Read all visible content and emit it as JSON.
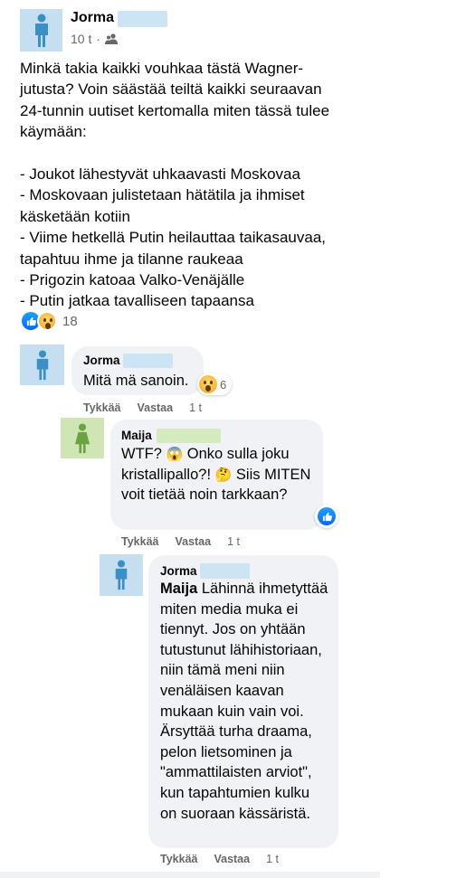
{
  "post": {
    "author": "Jorma",
    "time": "10 t",
    "separator": "·",
    "audience_icon": "friends-icon",
    "text": "Minkä takia kaikki vouhkaa tästä Wagner-\njutusta? Voin säästää teiltä kaikki seuraavan\n24-tunnin uutiset kertomalla miten tässä tulee\nkäymään:\n\n- Joukot lähestyvät uhkaavasti Moskovaa\n- Moskovaan julistetaan hätätila ja ihmiset\nkäsketään kotiin\n- Viime hetkellä Putin heilauttaa taikasauvaa,\ntapahtuu ihme ja tilanne raukeaa\n- Prigozin katoaa Valko-Venäjälle\n- Putin jatkaa tavalliseen tapaansa",
    "reactions": {
      "icons": [
        "like-icon",
        "wow-icon"
      ],
      "count": "18"
    }
  },
  "comments": [
    {
      "author": "Jorma",
      "text": "Mitä mä sanoin.",
      "reaction": {
        "icon": "wow-icon",
        "count": "6"
      },
      "like_label": "Tykkää",
      "reply_label": "Vastaa",
      "time": "1 t"
    },
    {
      "author": "Maija",
      "text_parts": [
        "WTF? ",
        " Onko sulla joku kristallipallo?! ",
        " Siis MITEN voit tietää noin tarkkaan?"
      ],
      "emojis": [
        "😱",
        "🤔"
      ],
      "reaction": {
        "icon": "like-icon"
      },
      "like_label": "Tykkää",
      "reply_label": "Vastaa",
      "time": "1 t"
    },
    {
      "author": "Jorma",
      "mention": "Maija",
      "text": " Lähinnä ihmetyttää miten media muka ei tiennyt. Jos on yhtään tutustunut lähihistoriaan, niin tämä meni niin venäläisen kaavan mukaan kuin vain voi. Ärsyttää turha draama, pelon lietsominen ja \"ammattilaisten arviot\", kun tapahtumien kulku on suoraan kässäristä.",
      "like_label": "Tykkää",
      "reply_label": "Vastaa",
      "time": "1 t"
    }
  ],
  "colors": {
    "accent": "#0866ff",
    "meta": "#65676b",
    "bubble": "#f0f2f5"
  }
}
